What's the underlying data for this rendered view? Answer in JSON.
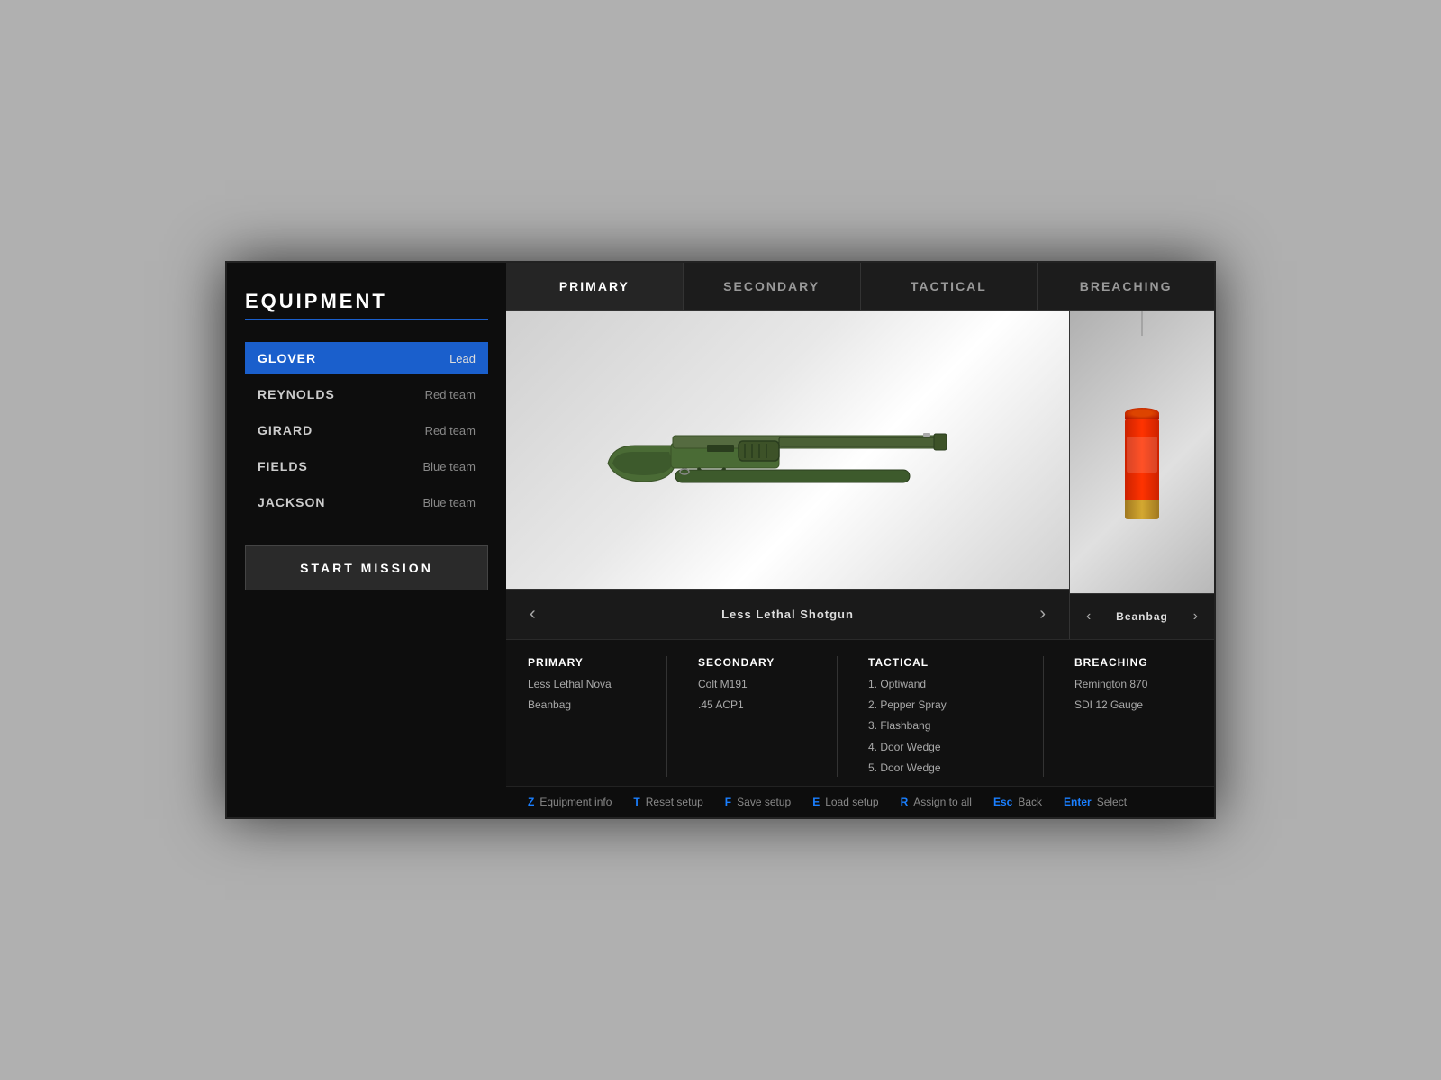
{
  "title": "EQUIPMENT",
  "title_underline_color": "#1a5fcc",
  "tabs": [
    {
      "label": "Primary",
      "active": true
    },
    {
      "label": "Secondary",
      "active": false
    },
    {
      "label": "Tactical",
      "active": false
    },
    {
      "label": "Breaching",
      "active": false
    }
  ],
  "team": [
    {
      "name": "Glover",
      "role": "Lead",
      "active": true
    },
    {
      "name": "Reynolds",
      "role": "Red team",
      "active": false
    },
    {
      "name": "Girard",
      "role": "Red team",
      "active": false
    },
    {
      "name": "Fields",
      "role": "Blue team",
      "active": false
    },
    {
      "name": "Jackson",
      "role": "Blue team",
      "active": false
    }
  ],
  "start_mission_label": "START MISSION",
  "primary_weapon_name": "Less Lethal Shotgun",
  "secondary_weapon_name": "Beanbag",
  "loadout": {
    "primary_label": "Primary",
    "primary_values": [
      "Less Lethal Nova",
      "Beanbag"
    ],
    "secondary_label": "Secondary",
    "secondary_values": [
      "Colt M191",
      ".45 ACP1"
    ],
    "tactical_label": "Tactical",
    "tactical_values": [
      "1. Optiwand",
      "2. Pepper Spray",
      "3. Flashbang",
      "4. Door Wedge",
      "5. Door Wedge"
    ],
    "breaching_label": "Breaching",
    "breaching_values": [
      "Remington 870",
      "SDI 12 Gauge"
    ]
  },
  "hotkeys": [
    {
      "key": "Z",
      "label": "Equipment info"
    },
    {
      "key": "T",
      "label": "Reset setup"
    },
    {
      "key": "F",
      "label": "Save setup"
    },
    {
      "key": "E",
      "label": "Load setup"
    },
    {
      "key": "R",
      "label": "Assign to all"
    },
    {
      "key": "Esc",
      "label": "Back"
    },
    {
      "key": "Enter",
      "label": "Select"
    }
  ]
}
